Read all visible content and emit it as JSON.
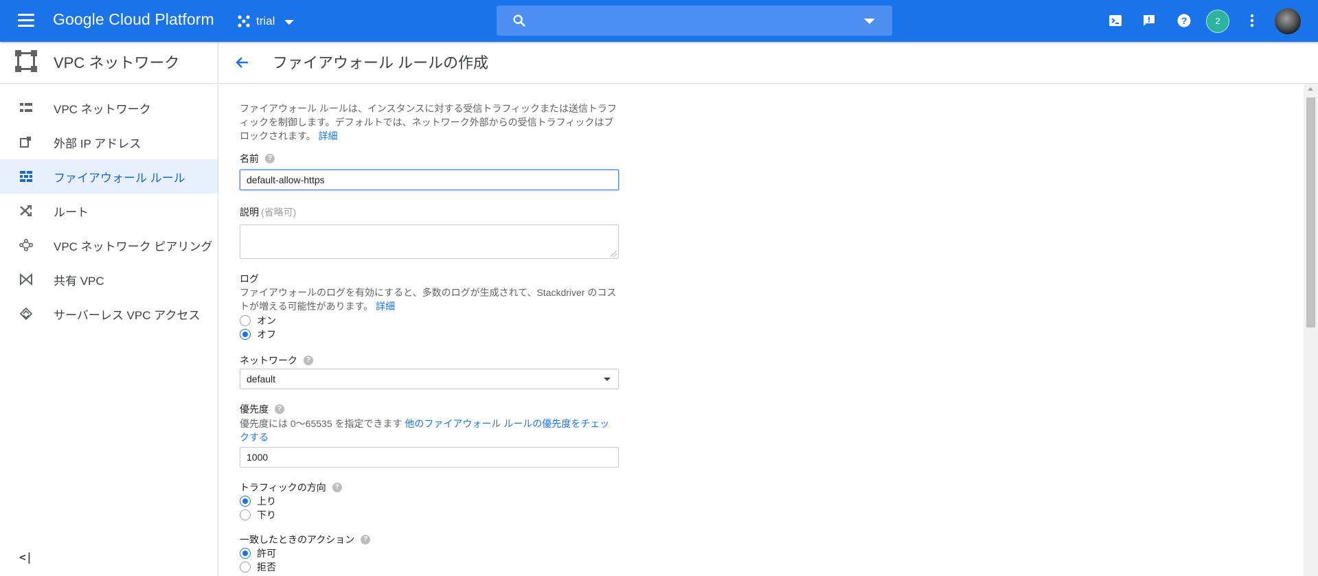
{
  "topbar": {
    "brand": "Google Cloud Platform",
    "project": "trial",
    "notification_count": "2",
    "colors": {
      "bar": "#1a73e8",
      "search_bg": "#4c8ef1",
      "badge": "#2db3a0"
    }
  },
  "sidebar": {
    "title": "VPC ネットワーク",
    "items": [
      {
        "label": "VPC ネットワーク",
        "icon": "vpc-network-icon",
        "active": false
      },
      {
        "label": "外部 IP アドレス",
        "icon": "external-ip-icon",
        "active": false
      },
      {
        "label": "ファイアウォール ルール",
        "icon": "firewall-icon",
        "active": true
      },
      {
        "label": "ルート",
        "icon": "routes-icon",
        "active": false
      },
      {
        "label": "VPC ネットワーク ピアリング",
        "icon": "peering-icon",
        "active": false
      },
      {
        "label": "共有 VPC",
        "icon": "shared-vpc-icon",
        "active": false
      },
      {
        "label": "サーバーレス VPC アクセス",
        "icon": "serverless-icon",
        "active": false
      }
    ],
    "collapse_label": "<|"
  },
  "page": {
    "title": "ファイアウォール ルールの作成"
  },
  "form": {
    "intro_text": "ファイアウォール ルールは、インスタンスに対する受信トラフィックまたは送信トラフィックを制御します。デフォルトでは、ネットワーク外部からの受信トラフィックはブロックされます。",
    "intro_link": "詳細",
    "name": {
      "label": "名前",
      "value": "default-allow-https"
    },
    "description": {
      "label": "説明",
      "optional": "(省略可)",
      "value": ""
    },
    "logs": {
      "label": "ログ",
      "help_text": "ファイアウォールのログを有効にすると、多数のログが生成されて、Stackdriver のコストが増える可能性があります。",
      "link": "詳細",
      "options": [
        {
          "label": "オン",
          "checked": false
        },
        {
          "label": "オフ",
          "checked": true
        }
      ]
    },
    "network": {
      "label": "ネットワーク",
      "value": "default"
    },
    "priority": {
      "label": "優先度",
      "help_text": "優先度には 0〜65535 を指定できます",
      "link": "他のファイアウォール ルールの優先度をチェックする",
      "value": "1000"
    },
    "direction": {
      "label": "トラフィックの方向",
      "options": [
        {
          "label": "上り",
          "checked": true
        },
        {
          "label": "下り",
          "checked": false
        }
      ]
    },
    "action": {
      "label": "一致したときのアクション",
      "options": [
        {
          "label": "許可",
          "checked": true
        },
        {
          "label": "拒否",
          "checked": false
        }
      ]
    }
  }
}
